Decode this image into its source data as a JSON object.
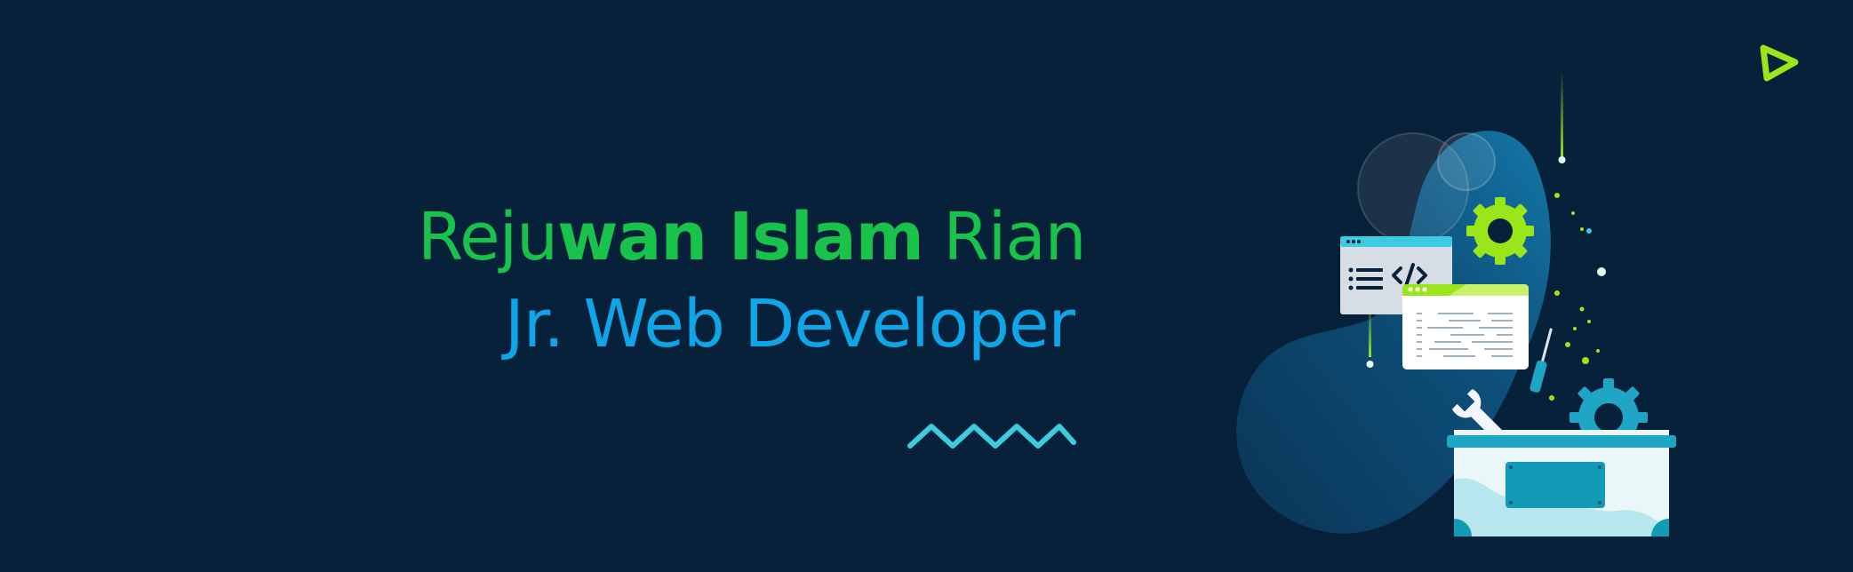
{
  "banner": {
    "name_part1": "Reju",
    "name_part2": "wan Islam",
    "name_part3": " Rian",
    "role": "Jr. Web Developer"
  },
  "icons": {
    "logo": "play-triangle-icon",
    "code_window": "code-brackets-icon",
    "gear": "gear-icon",
    "wrench": "wrench-icon",
    "screwdriver": "screwdriver-icon",
    "toolbox": "toolbox-icon"
  },
  "colors": {
    "background": "#08213a",
    "name_green": "#19c24a",
    "role_blue": "#0ea5e9",
    "accent_lime": "#9ae61a",
    "accent_cyan": "#3ccbe0"
  }
}
